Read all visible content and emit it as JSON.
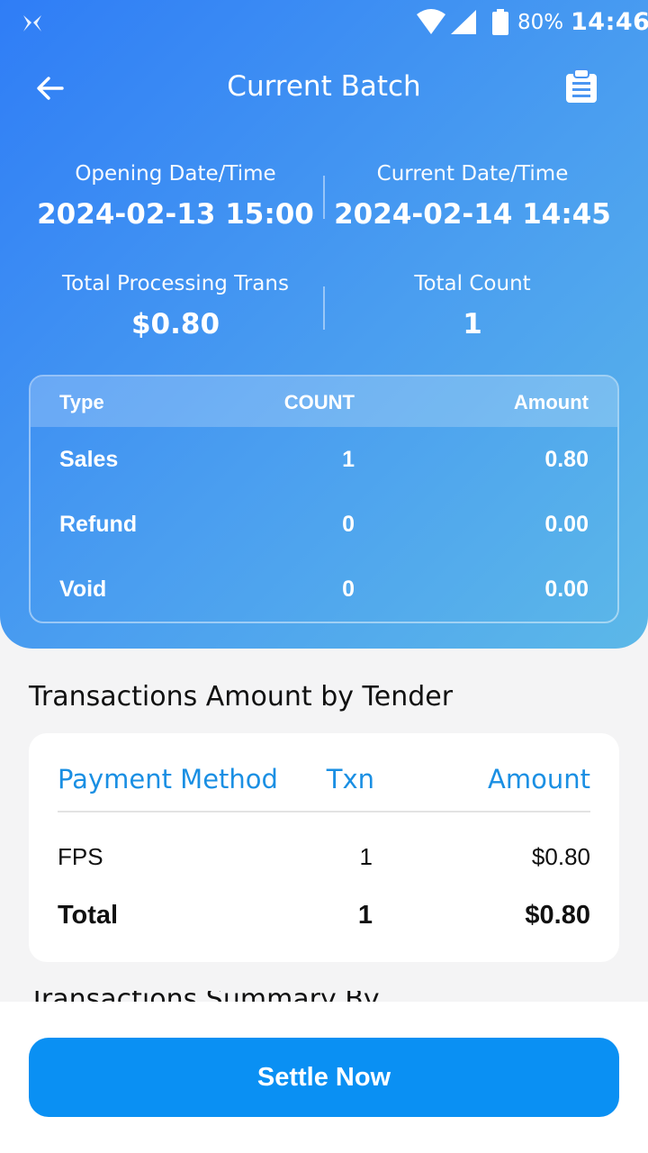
{
  "status_bar": {
    "battery": "80%",
    "time": "14:46"
  },
  "header": {
    "title": "Current Batch",
    "back_icon": "arrow-left-icon",
    "action_icon": "clipboard-icon"
  },
  "summary": {
    "opening": {
      "label": "Opening Date/Time",
      "value": "2024-02-13 15:00"
    },
    "current": {
      "label": "Current Date/Time",
      "value": "2024-02-14 14:45"
    },
    "total_processing": {
      "label": "Total Processing Trans",
      "value": "$0.80"
    },
    "total_count": {
      "label": "Total Count",
      "value": "1"
    }
  },
  "batch_table": {
    "headers": [
      "Type",
      "COUNT",
      "Amount"
    ],
    "rows": [
      [
        "Sales",
        "1",
        "0.80"
      ],
      [
        "Refund",
        "0",
        "0.00"
      ],
      [
        "Void",
        "0",
        "0.00"
      ]
    ]
  },
  "tender": {
    "title": "Transactions Amount by Tender",
    "headers": [
      "Payment Method",
      "Txn",
      "Amount"
    ],
    "rows": [
      [
        "FPS",
        "1",
        "$0.80"
      ]
    ],
    "total": [
      "Total",
      "1",
      "$0.80"
    ]
  },
  "next_section_partial": "Transactions Summary By ...",
  "actions": {
    "settle": "Settle Now"
  },
  "colors": {
    "primary": "#0a90f3",
    "accent_text": "#1a8fe3",
    "gradient_start": "#2f7df6",
    "gradient_end": "#5cb8e8"
  }
}
